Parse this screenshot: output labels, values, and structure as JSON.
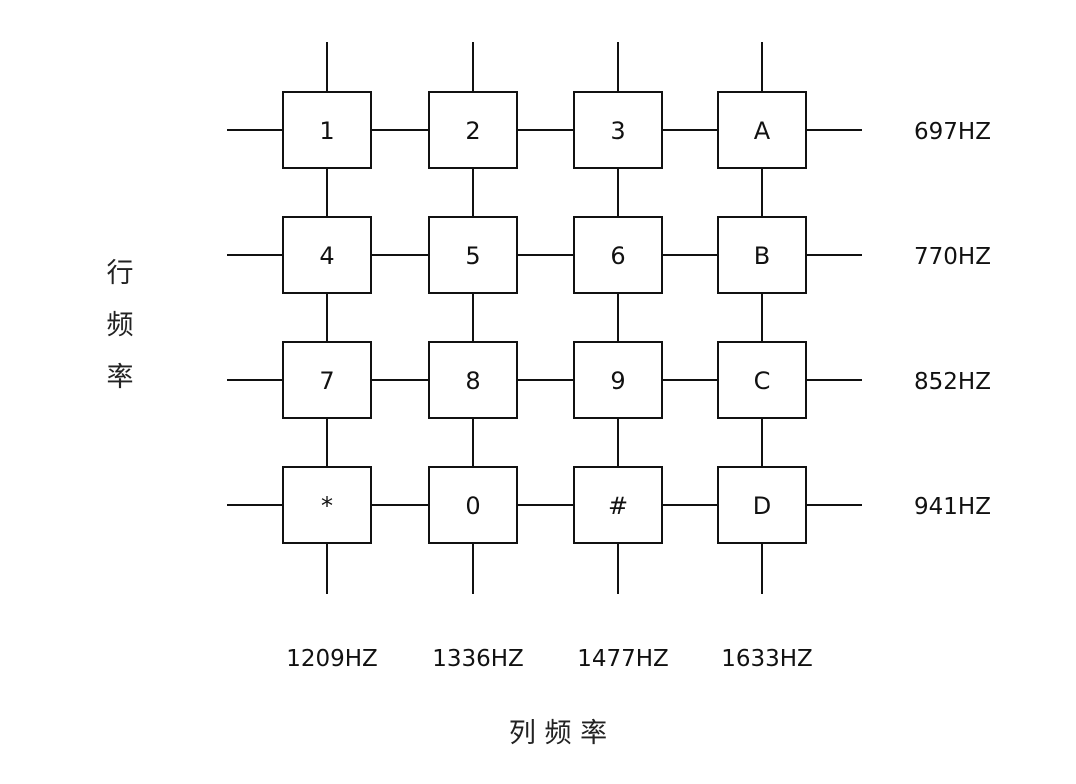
{
  "keypad": {
    "rows": [
      [
        "1",
        "2",
        "3",
        "A"
      ],
      [
        "4",
        "5",
        "6",
        "B"
      ],
      [
        "7",
        "8",
        "9",
        "C"
      ],
      [
        "*",
        "0",
        "#",
        "D"
      ]
    ]
  },
  "row_frequencies": [
    "697HZ",
    "770HZ",
    "852HZ",
    "941HZ"
  ],
  "column_frequencies": [
    "1209HZ",
    "1336HZ",
    "1477HZ",
    "1633HZ"
  ],
  "row_axis_label": "行频率",
  "column_axis_label": "列 频 率"
}
